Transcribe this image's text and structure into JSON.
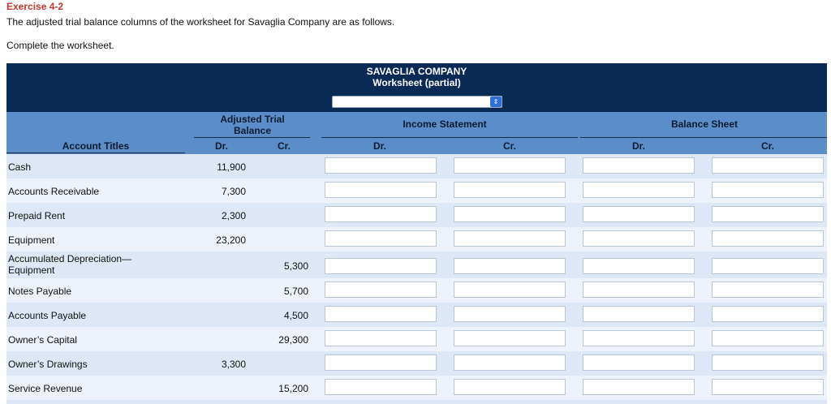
{
  "exercise_title": "Exercise 4-2",
  "intro_text": "The adjusted trial balance columns of the worksheet for Savaglia Company are as follows.",
  "instruction_text": "Complete the worksheet.",
  "company_name": "SAVAGLIA COMPANY",
  "worksheet_title": "Worksheet (partial)",
  "period_select": {
    "value": "",
    "icon": "select-arrows-icon"
  },
  "headers": {
    "account_titles": "Account Titles",
    "adjusted_trial_balance": "Adjusted Trial Balance",
    "income_statement": "Income Statement",
    "balance_sheet": "Balance Sheet",
    "dr": "Dr.",
    "cr": "Cr."
  },
  "rows": [
    {
      "title": "Cash",
      "dr": "11,900",
      "cr": ""
    },
    {
      "title": "Accounts Receivable",
      "dr": "7,300",
      "cr": ""
    },
    {
      "title": "Prepaid Rent",
      "dr": "2,300",
      "cr": ""
    },
    {
      "title": "Equipment",
      "dr": "23,200",
      "cr": ""
    },
    {
      "title": "Accumulated Depreciation—Equipment",
      "dr": "",
      "cr": "5,300"
    },
    {
      "title": "Notes Payable",
      "dr": "",
      "cr": "5,700"
    },
    {
      "title": "Accounts Payable",
      "dr": "",
      "cr": "4,500"
    },
    {
      "title": "Owner’s Capital",
      "dr": "",
      "cr": "29,300"
    },
    {
      "title": "Owner’s Drawings",
      "dr": "3,300",
      "cr": ""
    },
    {
      "title": "Service Revenue",
      "dr": "",
      "cr": "15,200"
    }
  ],
  "colors": {
    "title_red": "#c0392b",
    "banner_navy": "#0a2a56",
    "header_blue": "#5b8ec9",
    "row_alt": "#dde7f6",
    "row_light": "#edf2fb"
  }
}
